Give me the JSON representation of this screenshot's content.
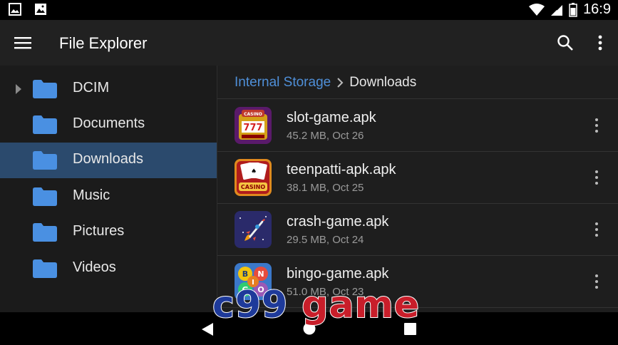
{
  "status_bar": {
    "time": "16:9",
    "icons": [
      "image-icon",
      "gallery-icon",
      "wifi-icon",
      "signal-icon",
      "battery-icon"
    ]
  },
  "app_bar": {
    "title": "File Explorer",
    "icons": [
      "menu-icon",
      "search-icon",
      "more-vert-icon"
    ]
  },
  "sidebar": {
    "items": [
      {
        "label": "DCIM",
        "expandable": true,
        "selected": false
      },
      {
        "label": "Documents",
        "expandable": false,
        "selected": false
      },
      {
        "label": "Downloads",
        "expandable": false,
        "selected": true
      },
      {
        "label": "Music",
        "expandable": false,
        "selected": false
      },
      {
        "label": "Pictures",
        "expandable": false,
        "selected": false
      },
      {
        "label": "Videos",
        "expandable": false,
        "selected": false
      }
    ]
  },
  "breadcrumb": {
    "root": "Internal Storage",
    "current": "Downloads"
  },
  "files": [
    {
      "name": "slot-game.apk",
      "meta": "45.2 MB, Oct 26",
      "icon": "slot-machine-icon"
    },
    {
      "name": "teenpatti-apk.apk",
      "meta": "38.1 MB, Oct 25",
      "icon": "casino-cards-icon"
    },
    {
      "name": "crash-game.apk",
      "meta": "29.5 MB, Oct 24",
      "icon": "rocket-icon"
    },
    {
      "name": "bingo-game.apk",
      "meta": "51.0 MB, Oct 23",
      "icon": "bingo-balls-icon"
    }
  ],
  "watermark": {
    "part1": "c99",
    "part2": "game"
  },
  "colors": {
    "accent": "#4f8fd8",
    "selected_bg": "#2b4a6d",
    "folder": "#4a90e2"
  }
}
